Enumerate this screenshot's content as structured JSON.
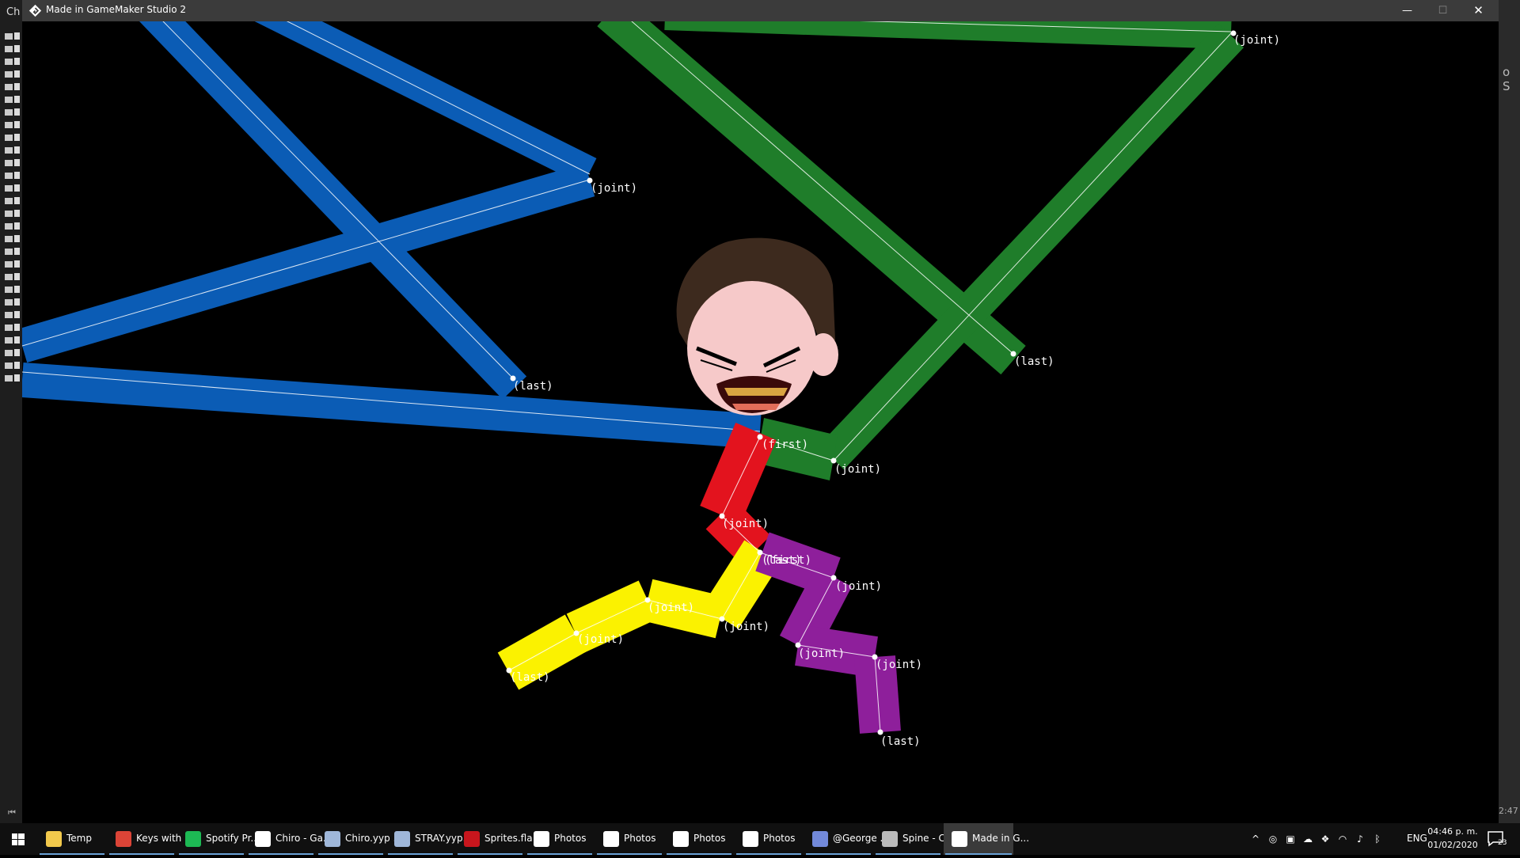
{
  "background_ide": {
    "left_title": "Ch",
    "right_text": "o S",
    "right_time": "2:47"
  },
  "window": {
    "title": "Made in GameMaker Studio 2",
    "min_glyph": "—",
    "max_glyph": "☐",
    "close_glyph": "✕"
  },
  "game": {
    "labels": {
      "blue_joint": "(joint)",
      "blue_last": "(last)",
      "green_joint_top": "(joint)",
      "green_last": "(last)",
      "green_joint_bottom": "(joint)",
      "red_first": "(first)",
      "red_joint": "(joint)",
      "red_last": "(last)",
      "yellow_joint_1": "(joint)",
      "yellow_joint_2": "(joint)",
      "yellow_joint_3": "(joint)",
      "yellow_last": "(last)",
      "purple_first": "(first)",
      "purple_joint_1": "(joint)",
      "purple_joint_2": "(joint)",
      "purple_joint_3": "(joint)",
      "purple_last": "(last)"
    },
    "colors": {
      "blue": "#0b5cb5",
      "green": "#1f7d2a",
      "red": "#e3131e",
      "yellow": "#fbf200",
      "purple": "#8e1f9b",
      "skin": "#f6c9c9",
      "hair": "#3d2a1e"
    }
  },
  "taskbar": {
    "apps": [
      {
        "label": "Temp",
        "icon": "folder-icon",
        "color": "#f2c94c"
      },
      {
        "label": "Keys with ...",
        "icon": "chrome-icon",
        "color": "#db4437"
      },
      {
        "label": "Spotify Pr...",
        "icon": "spotify-icon",
        "color": "#1db954"
      },
      {
        "label": "Chiro - Ga...",
        "icon": "gamemaker-icon",
        "color": "#ffffff"
      },
      {
        "label": "Chiro.yyp ...",
        "icon": "gamemaker-project-icon",
        "color": "#9fb7d9"
      },
      {
        "label": "STRAY.yyp...",
        "icon": "gamemaker-project-icon",
        "color": "#9fb7d9"
      },
      {
        "label": "Sprites.fla",
        "icon": "flash-icon",
        "color": "#c8161d"
      },
      {
        "label": "Photos",
        "icon": "photos-icon",
        "color": "#ffffff"
      },
      {
        "label": "Photos",
        "icon": "photos-icon",
        "color": "#ffffff"
      },
      {
        "label": "Photos",
        "icon": "photos-icon",
        "color": "#ffffff"
      },
      {
        "label": "Photos",
        "icon": "photos-icon",
        "color": "#ffffff"
      },
      {
        "label": "@George ...",
        "icon": "discord-icon",
        "color": "#7289da"
      },
      {
        "label": "Spine - C...",
        "icon": "spine-icon",
        "color": "#bbbbbb"
      },
      {
        "label": "Made in G...",
        "icon": "gamemaker-icon",
        "color": "#ffffff"
      }
    ],
    "tray": {
      "lang": "ENG",
      "time": "04:46 p. m.",
      "date": "01/02/2020",
      "notifications": "23"
    }
  }
}
